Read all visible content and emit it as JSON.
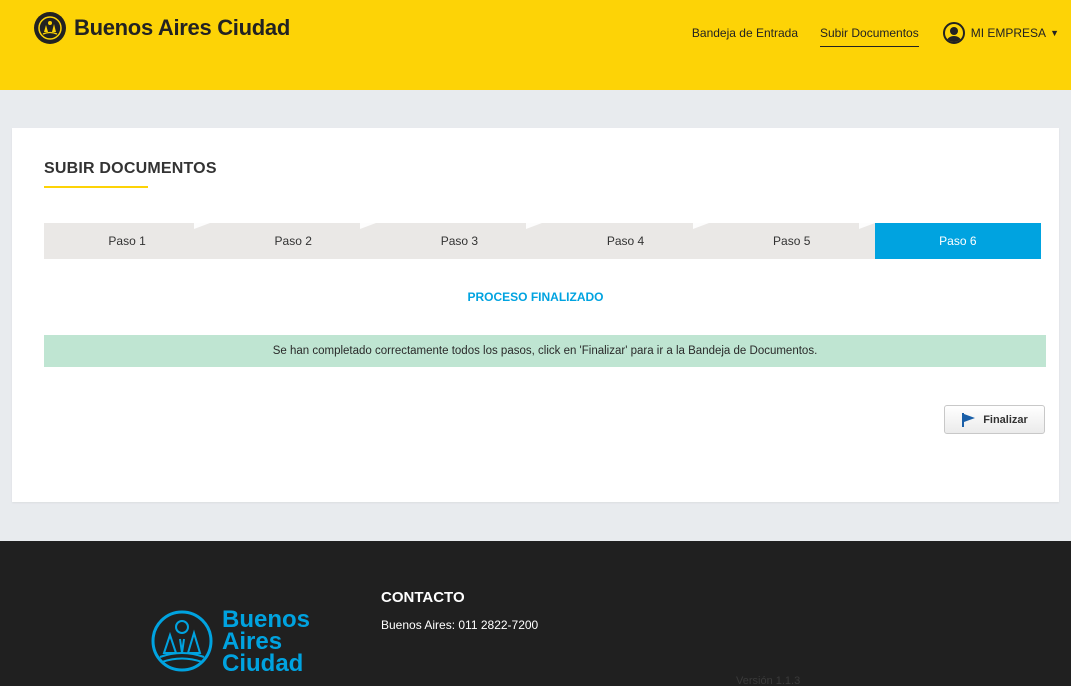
{
  "header": {
    "brand_name": "Buenos Aires Ciudad",
    "nav": {
      "inbox": "Bandeja de Entrada",
      "upload": "Subir Documentos",
      "user": "MI EMPRESA"
    }
  },
  "main": {
    "title": "SUBIR DOCUMENTOS",
    "steps": [
      "Paso 1",
      "Paso 2",
      "Paso 3",
      "Paso 4",
      "Paso 5",
      "Paso 6"
    ],
    "active_step": "Paso 6",
    "process_title": "PROCESO FINALIZADO",
    "alert_text": "Se han completado correctamente todos los pasos, click en 'Finalizar' para ir a la Bandeja de Documentos.",
    "finish_button": "Finalizar"
  },
  "footer": {
    "logo_lines": [
      "Buenos",
      "Aires",
      "Ciudad"
    ],
    "contact_title": "CONTACTO",
    "contact_phone": "Buenos Aires: 011 2822-7200",
    "version": "Versión 1.1.3"
  },
  "colors": {
    "header_bg": "#fdd306",
    "accent_blue": "#00a3e0",
    "alert_bg": "#bfe5d2",
    "footer_bg": "#202020"
  }
}
